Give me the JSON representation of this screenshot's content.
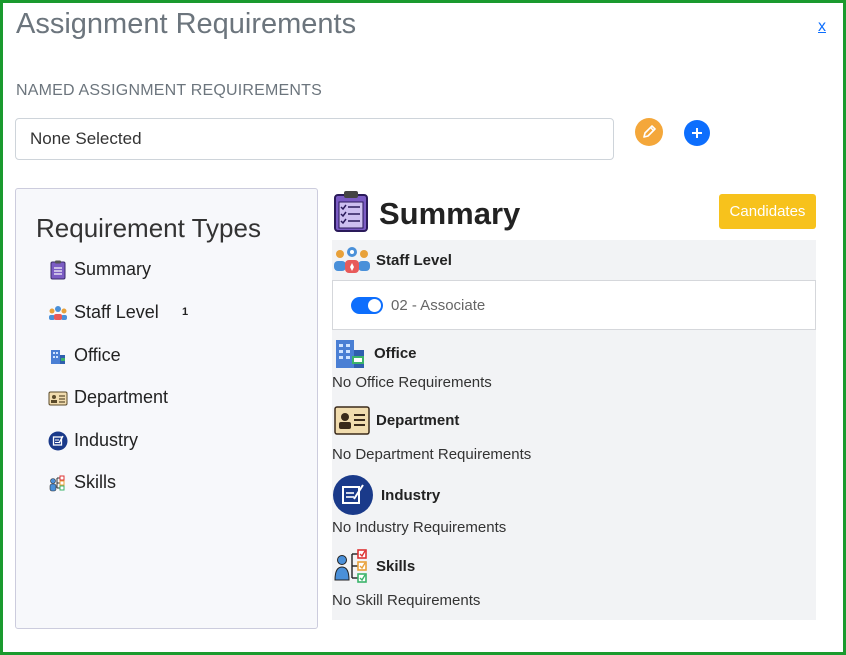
{
  "header": {
    "title": "Assignment Requirements",
    "close_label": "x"
  },
  "named": {
    "section_label": "NAMED ASSIGNMENT REQUIREMENTS",
    "selected_value": "None Selected"
  },
  "sidebar": {
    "title": "Requirement Types",
    "items": [
      {
        "label": "Summary",
        "icon": "clipboard-icon"
      },
      {
        "label": "Staff Level",
        "icon": "staff-level-icon",
        "badge": "1"
      },
      {
        "label": "Office",
        "icon": "office-building-icon"
      },
      {
        "label": "Department",
        "icon": "id-card-icon"
      },
      {
        "label": "Industry",
        "icon": "industry-icon"
      },
      {
        "label": "Skills",
        "icon": "skills-icon"
      }
    ]
  },
  "summary": {
    "title": "Summary",
    "candidates_label": "Candidates",
    "staff_level": {
      "label": "Staff Level",
      "selected": "02 - Associate",
      "toggle_on": true
    },
    "office": {
      "label": "Office",
      "empty_text": "No Office Requirements"
    },
    "department": {
      "label": "Department",
      "empty_text": "No Department Requirements"
    },
    "industry": {
      "label": "Industry",
      "empty_text": "No Industry Requirements"
    },
    "skills": {
      "label": "Skills",
      "empty_text": "No Skill Requirements"
    }
  },
  "colors": {
    "frame_border": "#1a9a2e",
    "accent_blue": "#0d6efd",
    "edit_orange": "#f4a73a",
    "candidates_yellow": "#f7c21c"
  }
}
